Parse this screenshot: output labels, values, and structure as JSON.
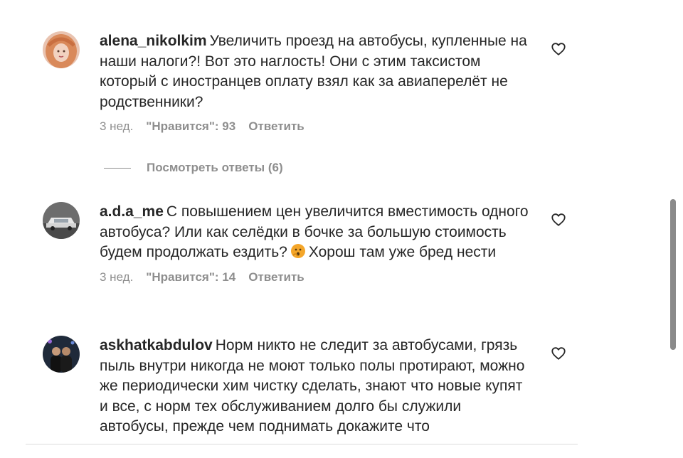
{
  "comments": [
    {
      "username": "alena_nikolkim",
      "text": "Увеличить проезд на автобусы, купленные на наши налоги?! Вот это наглость! Они с этим таксистом который с иностранцев оплату взял как за авиаперелёт не родственники?",
      "time": "3 нед.",
      "likes": "\"Нравится\": 93",
      "reply_label": "Ответить",
      "view_replies": "Посмотреть ответы (6)"
    },
    {
      "username": "a.d.a_me",
      "text_before_emoji": "С повышением цен увеличится вместимость одного автобуса? Или как селёдки в бочке за большую стоимость будем продолжать ездить?",
      "emoji": "thinking-face-icon",
      "text_after_emoji": "Хорош там уже бред нести",
      "time": "3 нед.",
      "likes": "\"Нравится\": 14",
      "reply_label": "Ответить"
    },
    {
      "username": "askhatkabdulov",
      "text": "Норм никто не следит за автобусами, грязь пыль внутри никогда не моют только полы протирают, можно же периодически хим чистку сделать, знают что новые купят и все, с норм тех обслуживанием долго бы служили автобусы, прежде чем поднимать докажите что"
    }
  ],
  "icons": {
    "like": "heart-outline-icon"
  }
}
